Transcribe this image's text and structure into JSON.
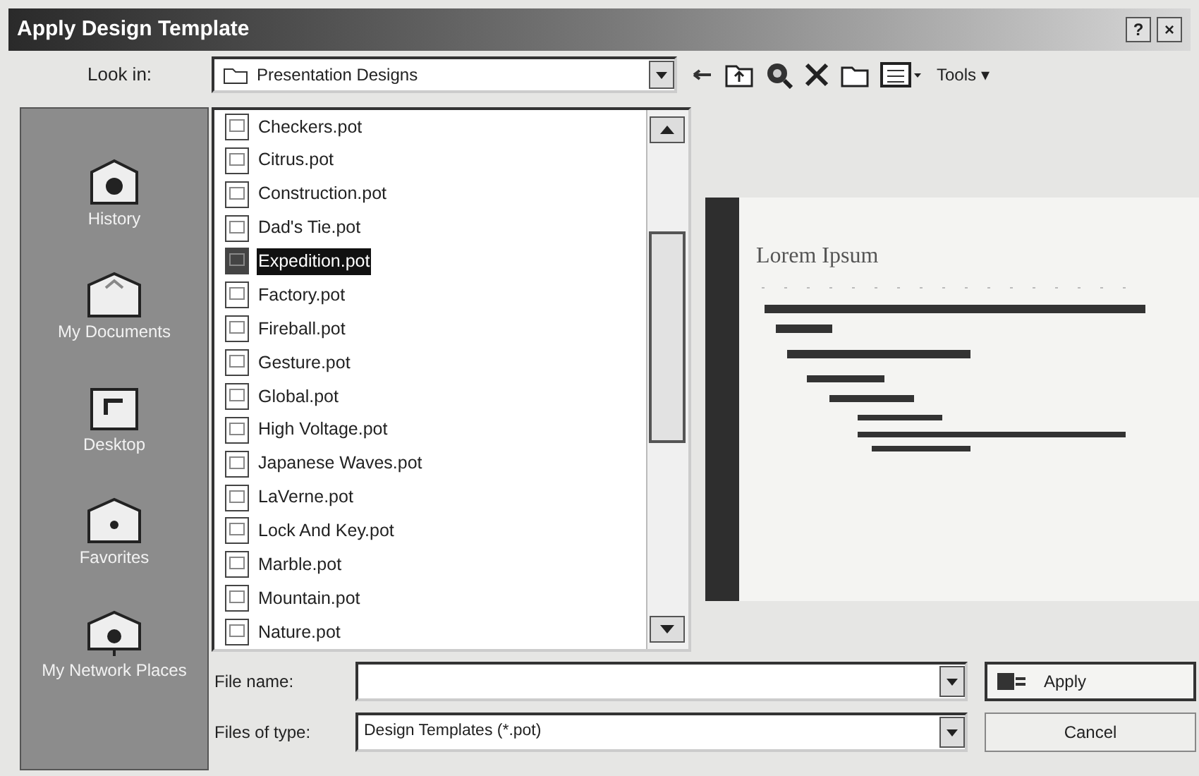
{
  "window": {
    "title": "Apply Design Template",
    "title_buttons": [
      "?",
      "×"
    ]
  },
  "toolbar": {
    "look_in_label": "Look in:",
    "look_in_value": "Presentation Designs",
    "tools_label": "Tools ▾"
  },
  "places": [
    {
      "label": "History",
      "selected": false
    },
    {
      "label": "My Documents",
      "selected": false
    },
    {
      "label": "Desktop",
      "selected": false
    },
    {
      "label": "Favorites",
      "selected": false
    },
    {
      "label": "My Network Places",
      "selected": false
    }
  ],
  "files": [
    {
      "name": "Checkers.pot",
      "selected": false
    },
    {
      "name": "Citrus.pot",
      "selected": false
    },
    {
      "name": "Construction.pot",
      "selected": false
    },
    {
      "name": "Dad's Tie.pot",
      "selected": false
    },
    {
      "name": "Expedition.pot",
      "selected": true
    },
    {
      "name": "Factory.pot",
      "selected": false
    },
    {
      "name": "Fireball.pot",
      "selected": false
    },
    {
      "name": "Gesture.pot",
      "selected": false
    },
    {
      "name": "Global.pot",
      "selected": false
    },
    {
      "name": "High Voltage.pot",
      "selected": false
    },
    {
      "name": "Japanese Waves.pot",
      "selected": false
    },
    {
      "name": "LaVerne.pot",
      "selected": false
    },
    {
      "name": "Lock And Key.pot",
      "selected": false
    },
    {
      "name": "Marble.pot",
      "selected": false
    },
    {
      "name": "Mountain.pot",
      "selected": false
    },
    {
      "name": "Nature.pot",
      "selected": false
    }
  ],
  "preview": {
    "title": "Lorem Ipsum"
  },
  "file_name": {
    "label": "File name:"
  },
  "files_of_type": {
    "label": "Files of type:",
    "value": "Design Templates (*.pot)"
  },
  "buttons": [
    "Apply",
    "Cancel"
  ]
}
